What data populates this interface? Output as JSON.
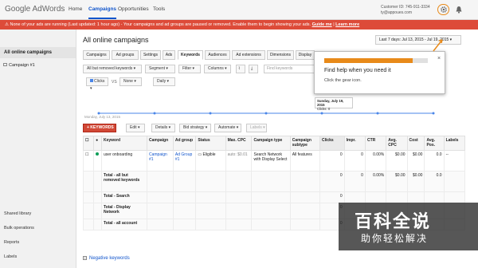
{
  "header": {
    "logo_google": "Google",
    "logo_product": "AdWords",
    "nav": [
      "Home",
      "Campaigns",
      "Opportunities",
      "Tools"
    ],
    "customer_id": "Customer ID: 745-911-3334",
    "customer_email": "ty@appoues.com"
  },
  "alert": {
    "message": "None of your ads are running (Last updated: 1 hour ago) - Your campaigns and ad groups are paused or removed. Enable them to begin showing your ads.",
    "guide_link": "Guide me",
    "learn_link": "Learn more"
  },
  "sidebar": {
    "all_campaigns": "All online campaigns",
    "campaign": "Campaign #1",
    "shared_library": "Shared library",
    "bulk_operations": "Bulk operations",
    "reports": "Reports",
    "labels": "Labels"
  },
  "main": {
    "title": "All online campaigns",
    "date_range": "Last 7 days: Jul 13, 2015 - Jul 19, 2015",
    "tabs": [
      "Campaigns",
      "Ad groups",
      "Settings",
      "Ads",
      "Keywords",
      "Audiences",
      "Ad extensions",
      "Dimensions",
      "Display"
    ],
    "filters": {
      "all_but_removed": "All but removed keywords",
      "segment": "Segment",
      "filter": "Filter",
      "columns": "Columns",
      "search_placeholder": "Find keywords"
    },
    "metrics": {
      "metric1": "Clicks",
      "vs": "VS",
      "metric2": "None",
      "period": "Daily"
    },
    "chart_start_label": "Monday, July 13, 2015",
    "tooltip_date": "Sunday, July 19, 2015",
    "tooltip_value": "Clicks: 0",
    "actions": {
      "add_keywords": "+ KEYWORDS",
      "edit": "Edit",
      "details": "Details",
      "bid_strategy": "Bid strategy",
      "automate": "Automate",
      "labels": "Labels"
    }
  },
  "table": {
    "headers": [
      "Keyword",
      "Campaign",
      "Ad group",
      "Status",
      "Max. CPC",
      "Campaign type",
      "Campaign subtype",
      "Clicks",
      "Impr.",
      "CTR",
      "Avg. CPC",
      "Cost",
      "Avg. Pos.",
      "Labels"
    ],
    "row": {
      "keyword": "user onboarding",
      "campaign": "Campaign #1",
      "ad_group": "Ad Group #1",
      "status": "Eligible",
      "max_cpc": "auto: $0.01",
      "campaign_type": "Search Network with Display Select",
      "campaign_subtype": "All features",
      "clicks": "0",
      "impr": "0",
      "ctr": "0.00%",
      "avg_cpc": "$0.00",
      "cost": "$0.00",
      "avg_pos": "0.0",
      "labels": "--"
    },
    "totals": [
      {
        "label": "Total - all but removed keywords",
        "clicks": "0",
        "impr": "0",
        "ctr": "0.00%",
        "avg_cpc": "$0.00",
        "cost": "$0.00",
        "avg_pos": "0.0"
      },
      {
        "label": "Total - Search",
        "clicks": "0"
      },
      {
        "label": "Total - Display Network",
        "clicks": "0"
      },
      {
        "label": "Total - all account",
        "clicks": "0"
      }
    ]
  },
  "popup": {
    "progress": 0.85,
    "title": "Find help when you need it",
    "text": "Click the gear icon.",
    "close": "×"
  },
  "watermark": {
    "line1": "百科全说",
    "line2": "助你轻松解决"
  },
  "negative_keywords": "Negative keywords"
}
